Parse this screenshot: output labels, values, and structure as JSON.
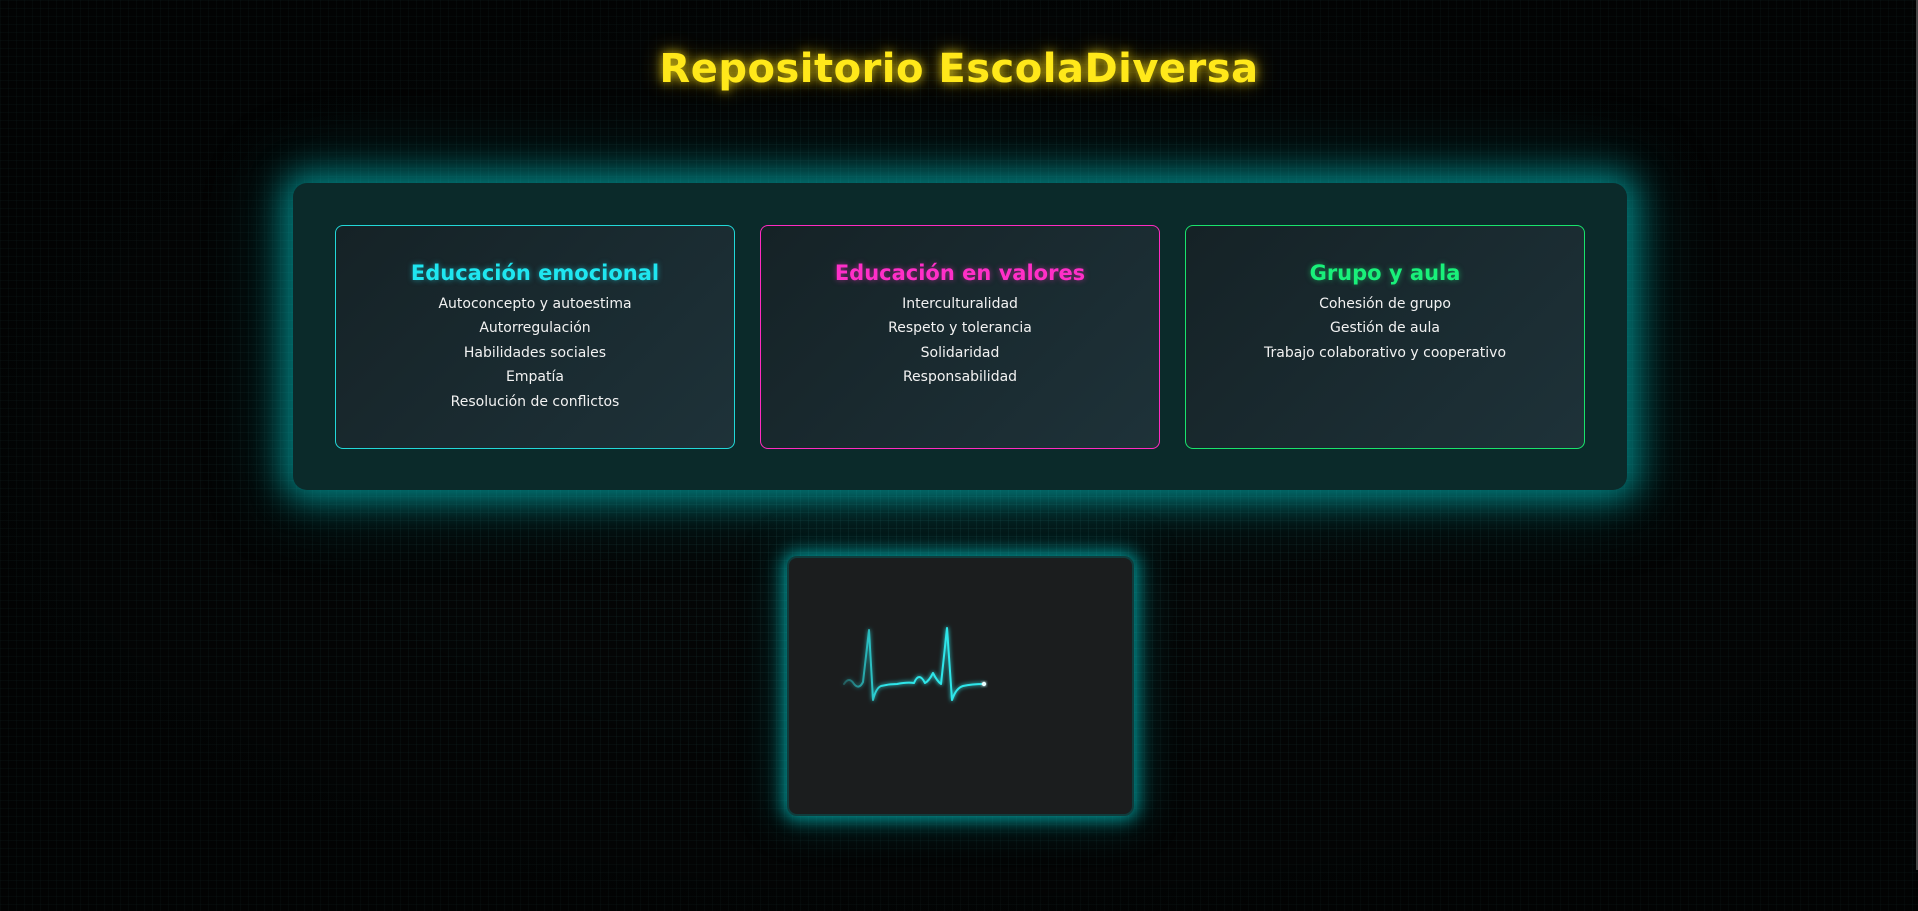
{
  "header": {
    "title": "Repositorio EscolaDiversa"
  },
  "categories": [
    {
      "title": "Educación emocional",
      "accent": "#1fe6f0",
      "items": [
        "Autoconcepto y autoestima",
        "Autorregulación",
        "Habilidades sociales",
        "Empatía",
        "Resolución de conflictos"
      ]
    },
    {
      "title": "Educación en valores",
      "accent": "#ff2fc8",
      "items": [
        "Interculturalidad",
        "Respeto y tolerancia",
        "Solidaridad",
        "Responsabilidad"
      ]
    },
    {
      "title": "Grupo y aula",
      "accent": "#19f07a",
      "items": [
        "Cohesión de grupo",
        "Gestión de aula",
        "Trabajo colaborativo y cooperativo"
      ]
    }
  ],
  "monitor": {
    "icon": "heartbeat-line-icon",
    "color": "#2ee6ea"
  },
  "colors": {
    "title": "#ffe81a",
    "panel_glow": "#00c8c8",
    "background": "#050707"
  }
}
